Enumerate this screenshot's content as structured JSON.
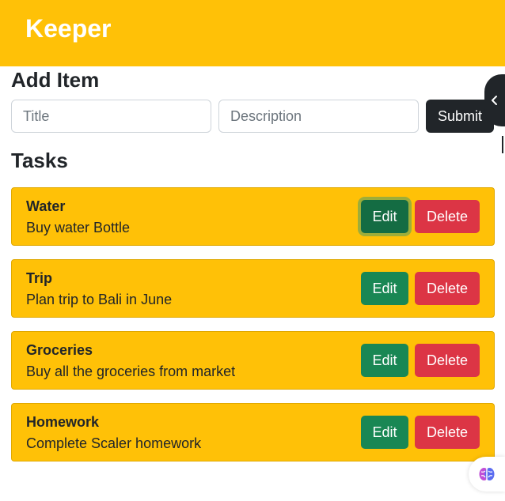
{
  "header": {
    "brand": "Keeper",
    "color": "#ffc107"
  },
  "add_item": {
    "heading": "Add Item",
    "title_placeholder": "Title",
    "description_placeholder": "Description",
    "submit_label": "Submit"
  },
  "tasks": {
    "heading": "Tasks",
    "edit_label": "Edit",
    "delete_label": "Delete",
    "items": [
      {
        "title": "Water",
        "description": "Buy water Bottle"
      },
      {
        "title": "Trip",
        "description": "Plan trip to Bali in June"
      },
      {
        "title": "Groceries",
        "description": "Buy all the groceries from market"
      },
      {
        "title": "Homework",
        "description": "Complete Scaler homework"
      }
    ]
  },
  "overlay": {
    "side_toggle_icon": "chevron-left-icon",
    "extension_icon": "brain-icon"
  },
  "colors": {
    "accent": "#ffc107",
    "submit": "#212529",
    "edit": "#198754",
    "delete": "#dc3545"
  }
}
